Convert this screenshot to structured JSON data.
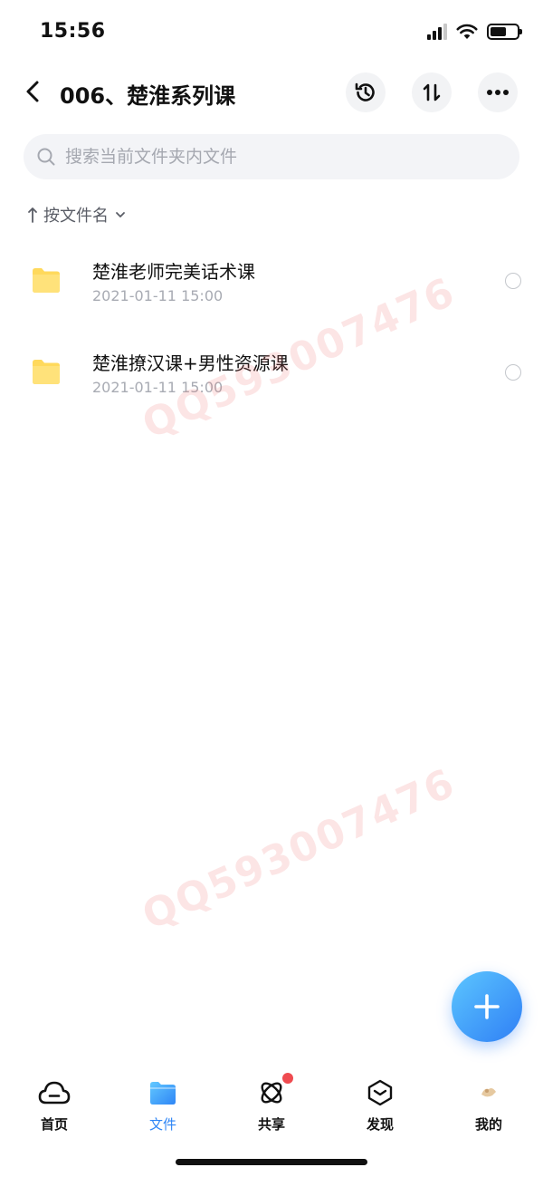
{
  "status_bar": {
    "time": "15:56"
  },
  "header": {
    "title": "006、楚淮系列课"
  },
  "search": {
    "placeholder": "搜索当前文件夹内文件"
  },
  "sort": {
    "label": "按文件名"
  },
  "files": [
    {
      "name": "楚淮老师完美话术课",
      "date": "2021-01-11 15:00"
    },
    {
      "name": "楚淮撩汉课+男性资源课",
      "date": "2021-01-11 15:00"
    }
  ],
  "watermark": {
    "text": "QQ593007476"
  },
  "bottom_nav": {
    "items": [
      {
        "label": "首页",
        "icon": "cloud-home-icon"
      },
      {
        "label": "文件",
        "icon": "folder-icon",
        "active": true
      },
      {
        "label": "共享",
        "icon": "share-orbit-icon",
        "badge": true
      },
      {
        "label": "发现",
        "icon": "discover-box-icon"
      },
      {
        "label": "我的",
        "icon": "avatar-icon"
      }
    ]
  },
  "colors": {
    "accent": "#2f86f6",
    "folder": "#ffd95c",
    "badge": "#ef4b50",
    "fab_start": "#5cc6ff",
    "fab_end": "#2f7ff5"
  }
}
